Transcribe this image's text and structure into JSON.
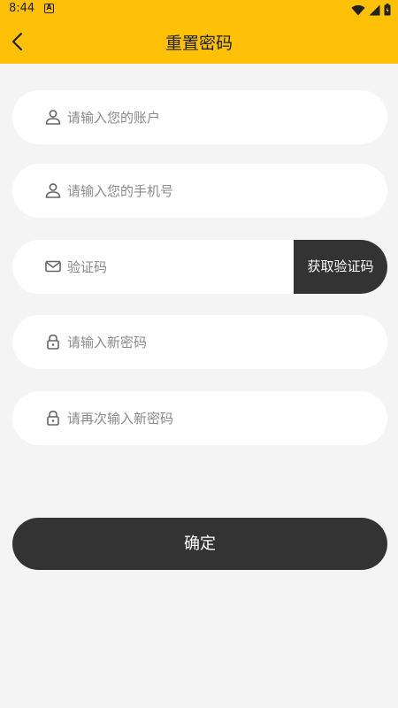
{
  "status_bar": {
    "time": "8:44",
    "notification_letter": "A"
  },
  "header": {
    "title": "重置密码"
  },
  "form": {
    "account": {
      "placeholder": "请输入您的账户",
      "value": ""
    },
    "phone": {
      "placeholder": "请输入您的手机号",
      "value": ""
    },
    "code": {
      "placeholder": "验证码",
      "value": "",
      "button_label": "获取验证码"
    },
    "new_password": {
      "placeholder": "请输入新密码",
      "value": ""
    },
    "confirm_password": {
      "placeholder": "请再次输入新密码",
      "value": ""
    }
  },
  "confirm_label": "确定",
  "colors": {
    "brand": "#ffc107",
    "dark": "#333333",
    "background": "#f4f4f4"
  }
}
